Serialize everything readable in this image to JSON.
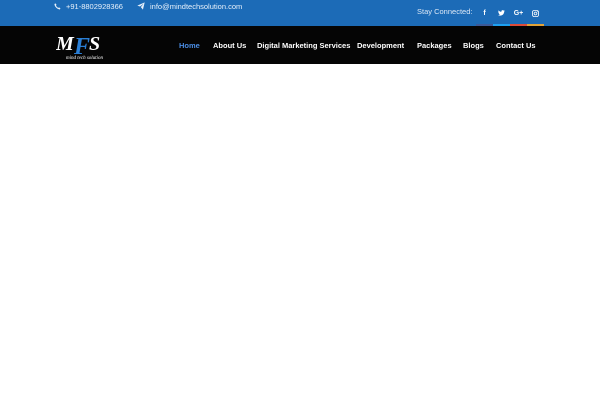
{
  "topbar": {
    "phone": "+91-8802928366",
    "email": "info@mindtechsolution.com",
    "stay_connected": "Stay Connected:",
    "social": [
      {
        "icon": "facebook-icon",
        "glyph": "f",
        "accent": "#3b5998"
      },
      {
        "icon": "twitter-icon",
        "glyph": "",
        "accent": "#1da1f2"
      },
      {
        "icon": "google-plus-icon",
        "glyph": "G+",
        "accent": "#dd4b39"
      },
      {
        "icon": "instagram-icon",
        "glyph": "",
        "accent": "#e1a33a"
      }
    ]
  },
  "navbar": {
    "logo": {
      "text": "MFS",
      "tagline": "mind tech solution"
    },
    "items": [
      {
        "label": "Home",
        "active": true
      },
      {
        "label": "About Us",
        "active": false
      },
      {
        "label": "Digital Marketing Services",
        "active": false
      },
      {
        "label": "Development",
        "active": false
      },
      {
        "label": "Packages",
        "active": false
      },
      {
        "label": "Blogs",
        "active": false
      },
      {
        "label": "Contact Us",
        "active": false
      }
    ]
  },
  "colors": {
    "topbar": "#1c6bb7",
    "navbar": "#050505",
    "active_link": "#4b8ee6"
  }
}
